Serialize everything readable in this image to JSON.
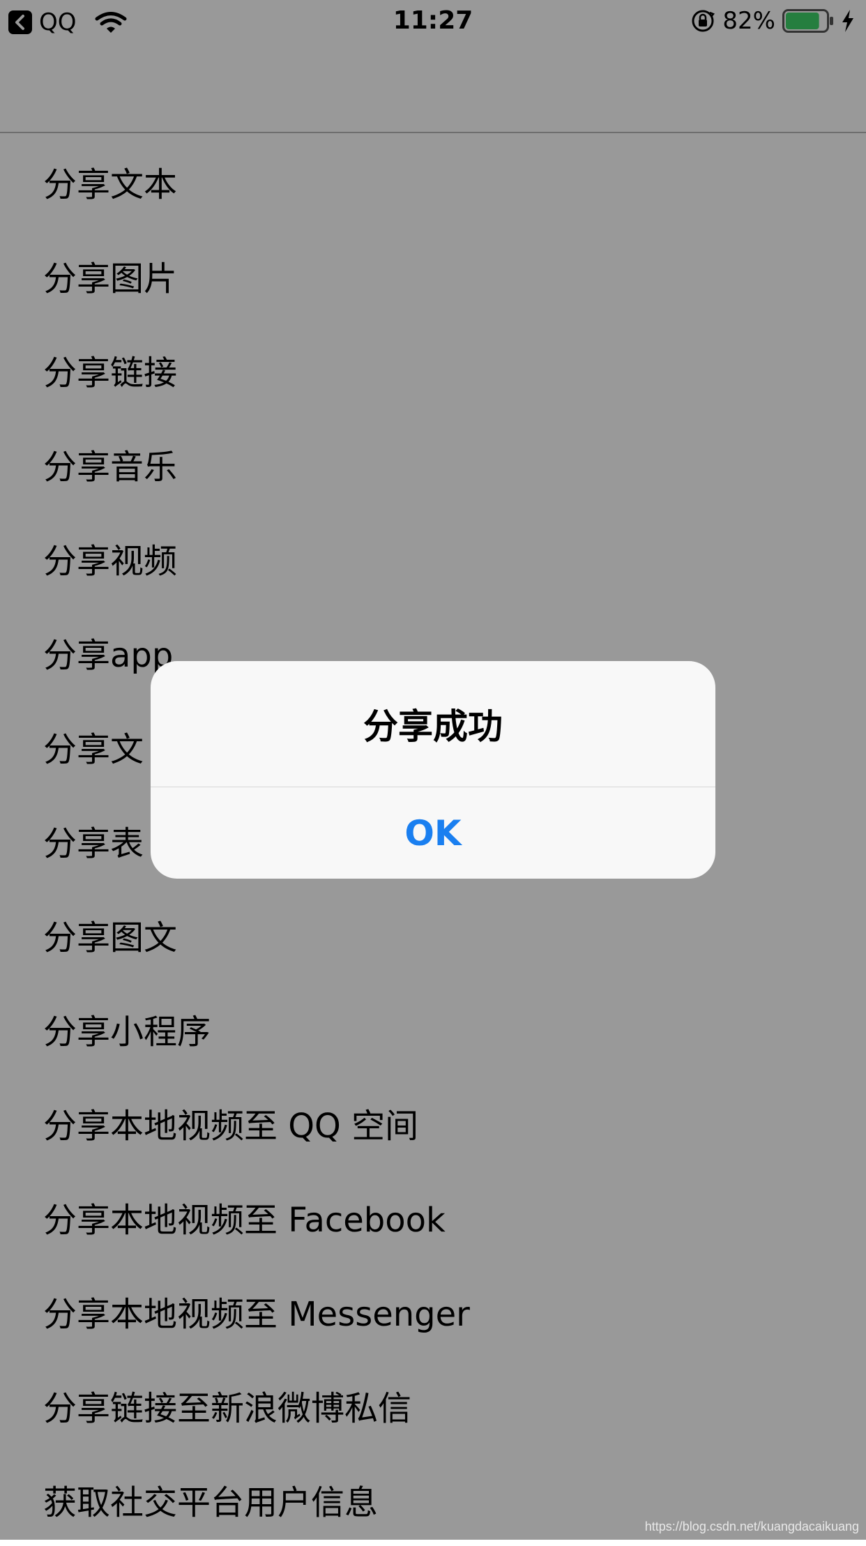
{
  "status_bar": {
    "back_app_label": "QQ",
    "time": "11:27",
    "battery_percent": "82%",
    "battery_level": 0.82,
    "battery_color": "#3fd26a"
  },
  "list": {
    "items": [
      "分享文本",
      "分享图片",
      "分享链接",
      "分享音乐",
      "分享视频",
      "分享app",
      "分享文",
      "分享表",
      "分享图文",
      "分享小程序",
      "分享本地视频至 QQ 空间",
      "分享本地视频至 Facebook",
      "分享本地视频至 Messenger",
      "分享链接至新浪微博私信",
      "获取社交平台用户信息"
    ]
  },
  "alert": {
    "title": "分享成功",
    "ok_label": "OK",
    "accent_color": "#1a7ff0"
  },
  "watermark": "https://blog.csdn.net/kuangdacaikuang"
}
